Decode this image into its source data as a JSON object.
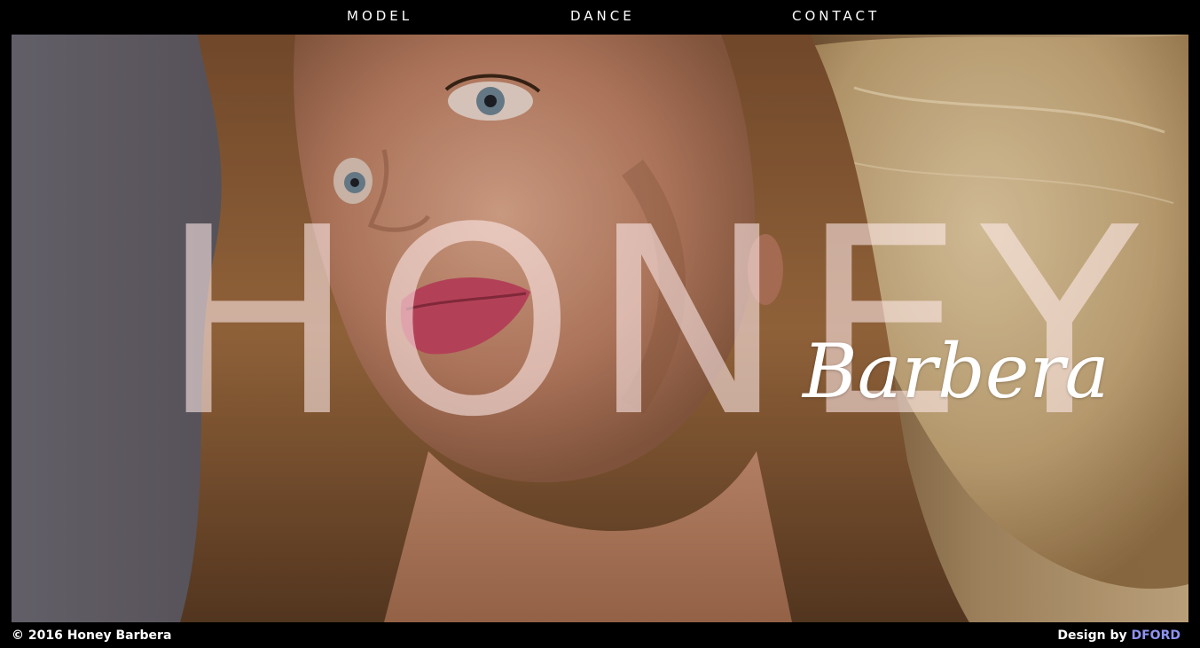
{
  "nav": {
    "items": [
      {
        "label": "MODEL"
      },
      {
        "label": "DANCE"
      },
      {
        "label": "CONTACT"
      }
    ]
  },
  "hero": {
    "title": "HONEY",
    "subtitle": "Barbera",
    "photo_subject": "portrait-photo"
  },
  "footer": {
    "copyright": "© 2016 Honey Barbera",
    "credit_prefix": "Design by",
    "credit_link": "DFORD"
  },
  "colors": {
    "background": "#000000",
    "nav_text": "#ffffff",
    "credit_link": "#8f93f2",
    "title_overlay": "rgba(255,235,235,0.58)"
  }
}
